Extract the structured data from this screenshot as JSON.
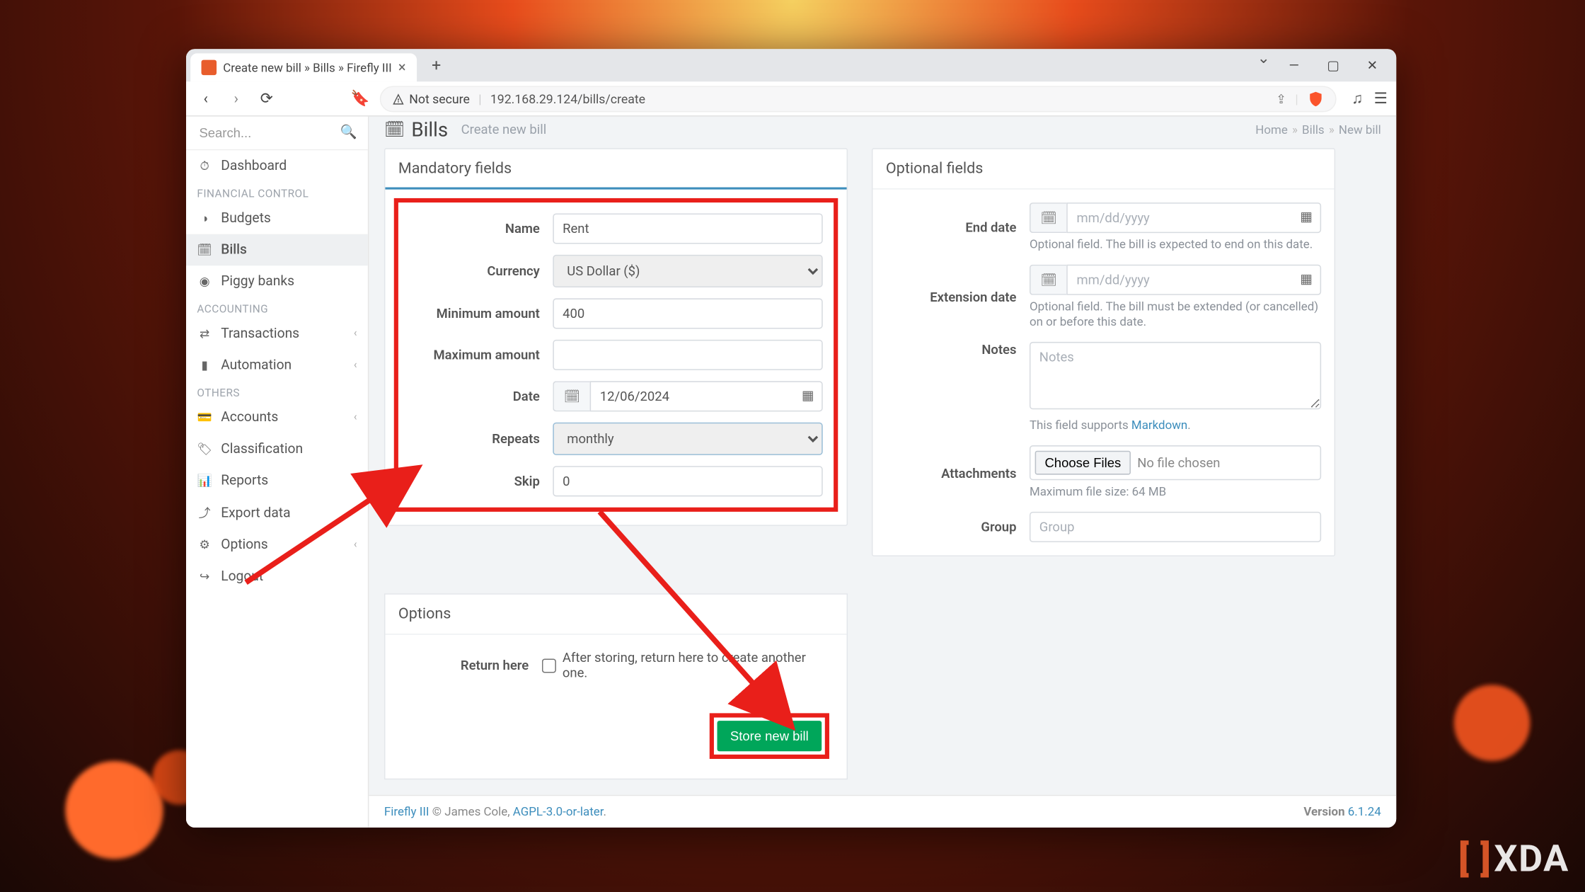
{
  "browser": {
    "tab_title": "Create new bill » Bills » Firefly III",
    "not_secure_label": "Not secure",
    "url": "192.168.29.124/bills/create"
  },
  "sidebar": {
    "search_placeholder": "Search...",
    "items": {
      "dashboard": "Dashboard",
      "section_financial": "FINANCIAL CONTROL",
      "budgets": "Budgets",
      "bills": "Bills",
      "piggy": "Piggy banks",
      "section_accounting": "ACCOUNTING",
      "transactions": "Transactions",
      "automation": "Automation",
      "section_others": "OTHERS",
      "accounts": "Accounts",
      "classification": "Classification",
      "reports": "Reports",
      "export": "Export data",
      "options": "Options",
      "logout": "Logout"
    }
  },
  "header": {
    "title": "Bills",
    "subtitle": "Create new bill",
    "breadcrumb": {
      "home": "Home",
      "bills": "Bills",
      "new": "New bill"
    }
  },
  "mandatory": {
    "panel_title": "Mandatory fields",
    "name_label": "Name",
    "name_value": "Rent",
    "currency_label": "Currency",
    "currency_value": "US Dollar ($)",
    "min_label": "Minimum amount",
    "min_value": "400",
    "max_label": "Maximum amount",
    "max_value": "",
    "date_label": "Date",
    "date_value": "12/06/2024",
    "repeats_label": "Repeats",
    "repeats_value": "monthly",
    "skip_label": "Skip",
    "skip_value": "0"
  },
  "optional": {
    "panel_title": "Optional fields",
    "end_label": "End date",
    "end_placeholder": "mm/dd/yyyy",
    "end_hint": "Optional field. The bill is expected to end on this date.",
    "ext_label": "Extension date",
    "ext_placeholder": "mm/dd/yyyy",
    "ext_hint": "Optional field. The bill must be extended (or cancelled) on or before this date.",
    "notes_label": "Notes",
    "notes_placeholder": "Notes",
    "notes_hint_pre": "This field supports ",
    "notes_hint_link": "Markdown",
    "attach_label": "Attachments",
    "attach_btn": "Choose Files",
    "attach_empty": "No file chosen",
    "attach_hint": "Maximum file size: 64 MB",
    "group_label": "Group",
    "group_placeholder": "Group"
  },
  "options_panel": {
    "title": "Options",
    "return_label": "Return here",
    "return_text": "After storing, return here to create another one.",
    "store_btn": "Store new bill"
  },
  "footer": {
    "product": "Firefly III",
    "copyright": " © James Cole, ",
    "license": "AGPL-3.0-or-later",
    "version_label": "Version ",
    "version": "6.1.24"
  },
  "watermark": "XDA"
}
